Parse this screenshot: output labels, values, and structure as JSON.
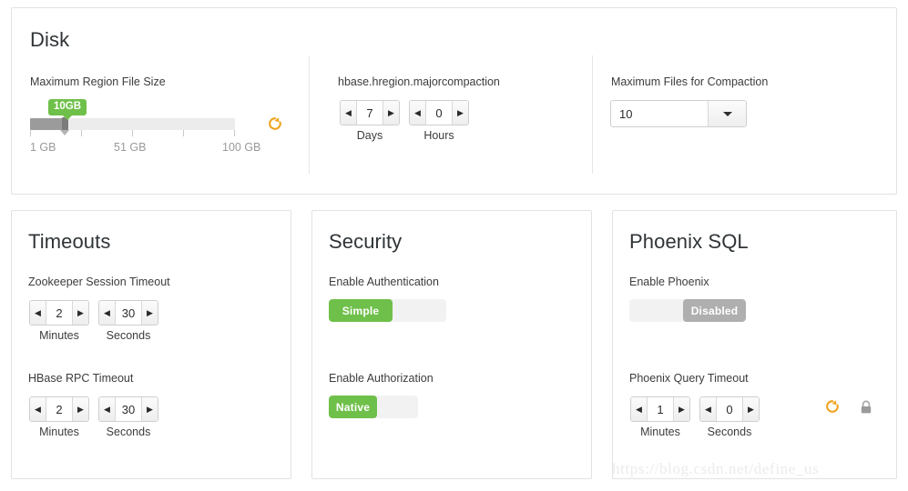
{
  "disk": {
    "title": "Disk",
    "region_size": {
      "label": "Maximum Region File Size",
      "badge": "10GB",
      "min_label": "1 GB",
      "mid_label": "51 GB",
      "max_label": "100 GB",
      "value": 10,
      "min": 1,
      "max": 100,
      "revert_icon": "revert-icon"
    },
    "majorcompaction": {
      "label": "hbase.hregion.majorcompaction",
      "days": {
        "value": "7",
        "caption": "Days"
      },
      "hours": {
        "value": "0",
        "caption": "Hours"
      }
    },
    "max_files": {
      "label": "Maximum Files for Compaction",
      "value": "10"
    }
  },
  "timeouts": {
    "title": "Timeouts",
    "zookeeper": {
      "label": "Zookeeper Session Timeout",
      "minutes": {
        "value": "2",
        "caption": "Minutes"
      },
      "seconds": {
        "value": "30",
        "caption": "Seconds"
      }
    },
    "rpc": {
      "label": "HBase RPC Timeout",
      "minutes": {
        "value": "2",
        "caption": "Minutes"
      },
      "seconds": {
        "value": "30",
        "caption": "Seconds"
      }
    }
  },
  "security": {
    "title": "Security",
    "authentication": {
      "label": "Enable Authentication",
      "state": "Simple",
      "on": true
    },
    "authorization": {
      "label": "Enable Authorization",
      "state": "Native",
      "on": true
    }
  },
  "phoenix": {
    "title": "Phoenix SQL",
    "enable": {
      "label": "Enable Phoenix",
      "state": "Disabled",
      "on": false
    },
    "query_timeout": {
      "label": "Phoenix Query Timeout",
      "minutes": {
        "value": "1",
        "caption": "Minutes"
      },
      "seconds": {
        "value": "0",
        "caption": "Seconds"
      },
      "revert_icon": "revert-icon",
      "lock_icon": "lock-icon"
    }
  },
  "spinner_glyphs": {
    "prev": "◀",
    "next": "▶"
  },
  "watermark": "https://blog.csdn.net/define_us",
  "colors": {
    "accent_green": "#6fc04a",
    "revert_orange": "#f0a21e",
    "toggle_off_gray": "#afafaf",
    "panel_border": "#e2e2e2"
  }
}
